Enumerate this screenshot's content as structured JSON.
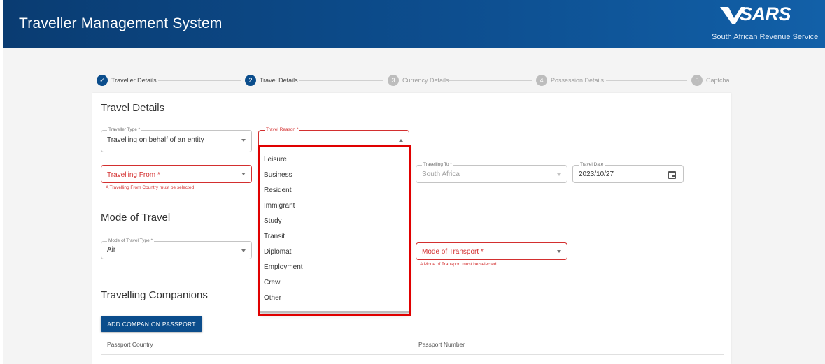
{
  "header": {
    "title": "Traveller Management System",
    "logo_text": "SARS",
    "logo_subtitle": "South African Revenue Service",
    "bg_color": "#0d4e8f"
  },
  "stepper": {
    "steps": [
      {
        "number": "✓",
        "label": "Traveller Details",
        "state": "completed"
      },
      {
        "number": "2",
        "label": "Travel Details",
        "state": "active"
      },
      {
        "number": "3",
        "label": "Currency Details",
        "state": "pending"
      },
      {
        "number": "4",
        "label": "Possession Details",
        "state": "pending"
      },
      {
        "number": "5",
        "label": "Captcha",
        "state": "pending"
      }
    ]
  },
  "travel_details": {
    "title": "Travel Details",
    "traveller_type": {
      "label": "Traveller Type *",
      "value": "Travelling on behalf of an entity"
    },
    "travel_reason": {
      "label": "Travel Reason *",
      "value": ""
    },
    "travelling_from": {
      "placeholder": "Travelling From *",
      "error": "A Travelling From Country must be selected"
    },
    "travelling_to": {
      "label": "Travelling To *",
      "value": "South Africa"
    },
    "travel_date": {
      "label": "Travel Date",
      "value": "2023/10/27"
    }
  },
  "mode_of_travel": {
    "title": "Mode of Travel",
    "type": {
      "label": "Mode of Travel Type *",
      "value": "Air"
    },
    "transport": {
      "placeholder": "Mode of Transport *",
      "error": "A Mode of Transport must be selected"
    }
  },
  "companions": {
    "title": "Travelling Companions",
    "add_button": "ADD COMPANION PASSPORT",
    "columns": [
      "Passport Country",
      "Passport Number"
    ]
  },
  "travel_reason_options": [
    "Leisure",
    "Business",
    "Resident",
    "Immigrant",
    "Study",
    "Transit",
    "Diplomat",
    "Employment",
    "Crew",
    "Other"
  ],
  "colors": {
    "primary": "#0b4d8c",
    "error": "#d32f2f",
    "highlight": "#e00000"
  }
}
